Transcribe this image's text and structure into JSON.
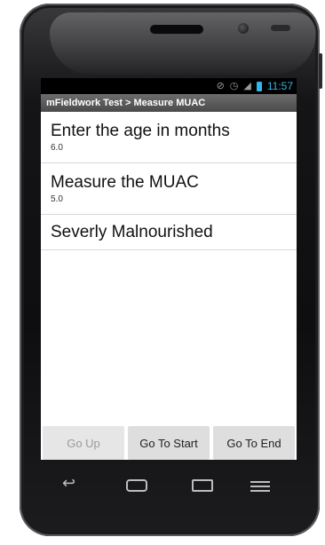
{
  "status_bar": {
    "time": "11:57",
    "icons": [
      "mute-icon",
      "alarm-icon",
      "signal-icon",
      "battery-icon"
    ],
    "accent_color": "#33b5e5"
  },
  "title_bar": {
    "text": "mFieldwork Test > Measure MUAC"
  },
  "list": {
    "items": [
      {
        "title": "Enter the age in months",
        "value": "6.0"
      },
      {
        "title": "Measure the MUAC",
        "value": "5.0"
      },
      {
        "title": "Severly Malnourished"
      }
    ]
  },
  "buttons": {
    "go_up": "Go Up",
    "go_to_start": "Go To Start",
    "go_to_end": "Go To End"
  },
  "nav_keys": [
    "back-icon",
    "home-icon",
    "recent-apps-icon",
    "menu-icon"
  ]
}
